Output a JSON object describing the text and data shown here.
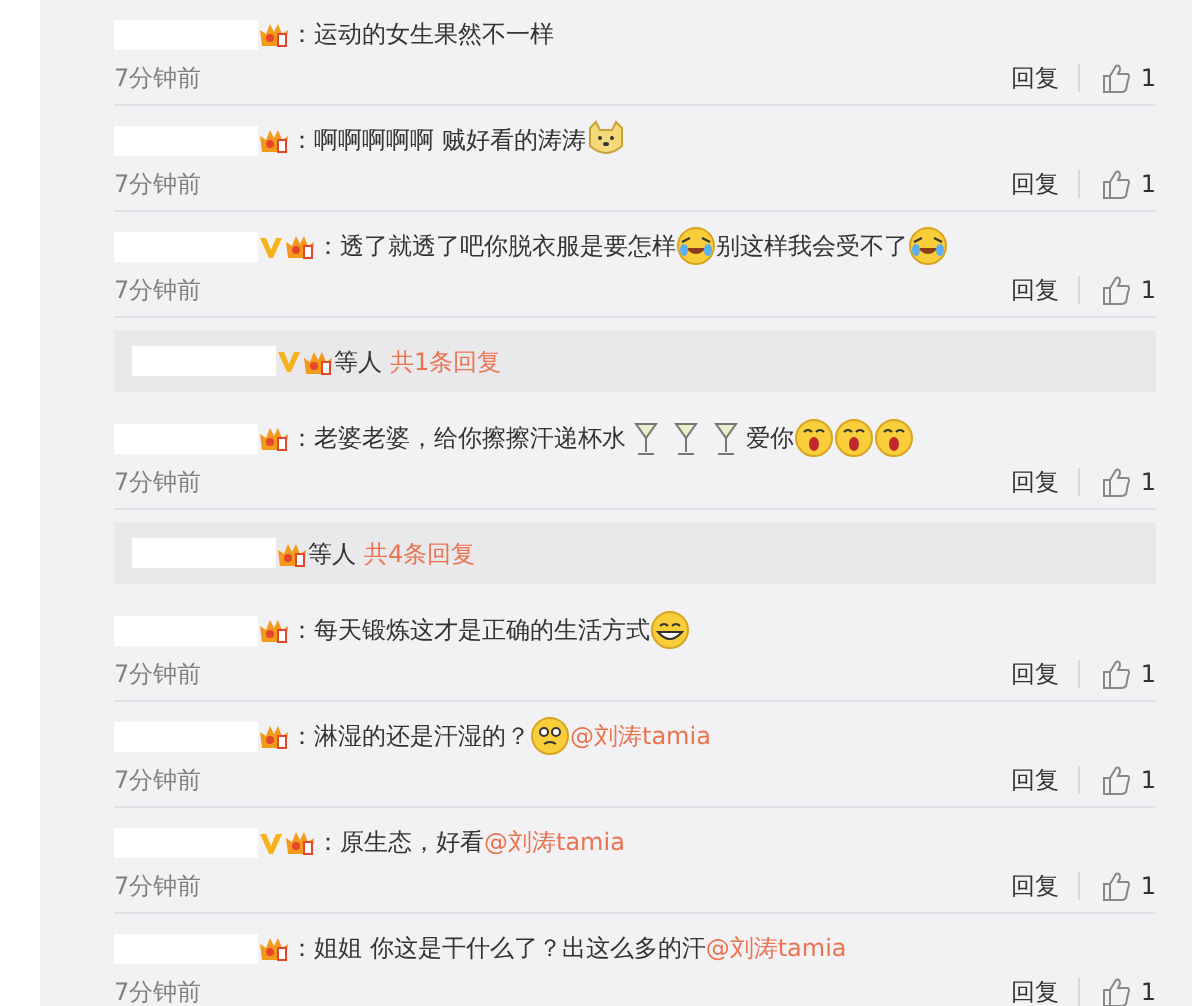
{
  "items": [
    {
      "kind": "comment",
      "verified": false,
      "parts": [
        {
          "kind": "text",
          "text": "：运动的女生果然不一样"
        }
      ],
      "time": "7分钟前",
      "reply": "回复",
      "likes": "1"
    },
    {
      "kind": "comment",
      "verified": false,
      "parts": [
        {
          "kind": "text",
          "text": "：啊啊啊啊啊 贼好看的涛涛"
        },
        {
          "kind": "doge"
        }
      ],
      "time": "7分钟前",
      "reply": "回复",
      "likes": "1"
    },
    {
      "kind": "comment",
      "verified": true,
      "parts": [
        {
          "kind": "text",
          "text": "：透了就透了吧你脱衣服是要怎样"
        },
        {
          "kind": "laughcry"
        },
        {
          "kind": "text",
          "text": "别这样我会受不了"
        },
        {
          "kind": "laughcry"
        }
      ],
      "time": "7分钟前",
      "reply": "回复",
      "likes": "1"
    },
    {
      "kind": "replies",
      "verified": true,
      "others": "等人",
      "count": "共1条回复"
    },
    {
      "kind": "comment",
      "verified": false,
      "parts": [
        {
          "kind": "text",
          "text": "：老婆老婆，给你擦擦汗递杯水"
        },
        {
          "kind": "cocktail"
        },
        {
          "kind": "cocktail"
        },
        {
          "kind": "cocktail"
        },
        {
          "kind": "text",
          "text": "爱你"
        },
        {
          "kind": "shocked"
        },
        {
          "kind": "shocked"
        },
        {
          "kind": "shocked"
        }
      ],
      "time": "7分钟前",
      "reply": "回复",
      "likes": "1"
    },
    {
      "kind": "replies",
      "verified": false,
      "others": "等人",
      "count": "共4条回复"
    },
    {
      "kind": "comment",
      "verified": false,
      "parts": [
        {
          "kind": "text",
          "text": "：每天锻炼这才是正确的生活方式"
        },
        {
          "kind": "grin"
        }
      ],
      "time": "7分钟前",
      "reply": "回复",
      "likes": "1"
    },
    {
      "kind": "comment",
      "verified": false,
      "parts": [
        {
          "kind": "text",
          "text": "：淋湿的还是汗湿的？"
        },
        {
          "kind": "dizzy"
        },
        {
          "kind": "mention",
          "text": "@刘涛tamia"
        }
      ],
      "time": "7分钟前",
      "reply": "回复",
      "likes": "1"
    },
    {
      "kind": "comment",
      "verified": true,
      "parts": [
        {
          "kind": "text",
          "text": "：原生态，好看"
        },
        {
          "kind": "mention",
          "text": "@刘涛tamia"
        }
      ],
      "time": "7分钟前",
      "reply": "回复",
      "likes": "1"
    },
    {
      "kind": "comment",
      "verified": false,
      "parts": [
        {
          "kind": "text",
          "text": "：姐姐  你这是干什么了？出这么多的汗"
        },
        {
          "kind": "mention",
          "text": "@刘涛tamia"
        }
      ],
      "time": "7分钟前",
      "reply": "回复",
      "likes": "1"
    }
  ]
}
